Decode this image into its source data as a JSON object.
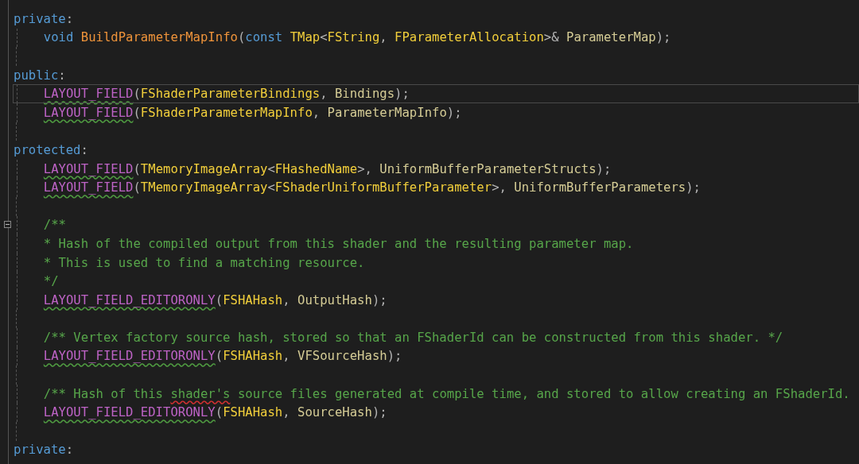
{
  "editor": {
    "lines": [
      {
        "kind": "code",
        "indented": false,
        "current": false,
        "fold": false,
        "tokens": [
          {
            "kind": "keyword",
            "text": "private"
          },
          {
            "kind": "punct",
            "text": ":"
          }
        ]
      },
      {
        "kind": "code",
        "indented": true,
        "current": false,
        "fold": false,
        "tokens": [
          {
            "kind": "keyword",
            "text": "void "
          },
          {
            "kind": "function",
            "text": "BuildParameterMapInfo"
          },
          {
            "kind": "punct",
            "text": "("
          },
          {
            "kind": "keyword",
            "text": "const "
          },
          {
            "kind": "type",
            "text": "TMap"
          },
          {
            "kind": "punct",
            "text": "<"
          },
          {
            "kind": "type",
            "text": "FString"
          },
          {
            "kind": "punct",
            "text": ", "
          },
          {
            "kind": "type",
            "text": "FParameterAllocation"
          },
          {
            "kind": "punct",
            "text": ">& "
          },
          {
            "kind": "param",
            "text": "ParameterMap"
          },
          {
            "kind": "punct",
            "text": ");"
          }
        ]
      },
      {
        "kind": "blank"
      },
      {
        "kind": "code",
        "indented": false,
        "current": false,
        "fold": false,
        "tokens": [
          {
            "kind": "keyword",
            "text": "public"
          },
          {
            "kind": "punct",
            "text": ":"
          }
        ]
      },
      {
        "kind": "code",
        "indented": true,
        "current": true,
        "fold": false,
        "tokens": [
          {
            "kind": "macro",
            "text": "LAYOUT_FIELD",
            "squiggly": true
          },
          {
            "kind": "punct",
            "text": "("
          },
          {
            "kind": "type",
            "text": "FShaderParameterBindings"
          },
          {
            "kind": "punct",
            "text": ", "
          },
          {
            "kind": "param",
            "text": "Bindings"
          },
          {
            "kind": "punct",
            "text": ");"
          }
        ]
      },
      {
        "kind": "code",
        "indented": true,
        "current": false,
        "fold": false,
        "tokens": [
          {
            "kind": "macro",
            "text": "LAYOUT_FIELD",
            "squiggly": true
          },
          {
            "kind": "punct",
            "text": "("
          },
          {
            "kind": "type",
            "text": "FShaderParameterMapInfo"
          },
          {
            "kind": "punct",
            "text": ", "
          },
          {
            "kind": "param",
            "text": "ParameterMapInfo"
          },
          {
            "kind": "punct",
            "text": ");"
          }
        ]
      },
      {
        "kind": "blank"
      },
      {
        "kind": "code",
        "indented": false,
        "current": false,
        "fold": false,
        "tokens": [
          {
            "kind": "keyword",
            "text": "protected"
          },
          {
            "kind": "punct",
            "text": ":"
          }
        ]
      },
      {
        "kind": "code",
        "indented": true,
        "current": false,
        "fold": false,
        "tokens": [
          {
            "kind": "macro",
            "text": "LAYOUT_FIELD",
            "squiggly": true
          },
          {
            "kind": "punct",
            "text": "("
          },
          {
            "kind": "type",
            "text": "TMemoryImageArray"
          },
          {
            "kind": "punct",
            "text": "<"
          },
          {
            "kind": "type",
            "text": "FHashedName"
          },
          {
            "kind": "punct",
            "text": ">, "
          },
          {
            "kind": "param",
            "text": "UniformBufferParameterStructs"
          },
          {
            "kind": "punct",
            "text": ");"
          }
        ]
      },
      {
        "kind": "code",
        "indented": true,
        "current": false,
        "fold": false,
        "tokens": [
          {
            "kind": "macro",
            "text": "LAYOUT_FIELD",
            "squiggly": true
          },
          {
            "kind": "punct",
            "text": "("
          },
          {
            "kind": "type",
            "text": "TMemoryImageArray"
          },
          {
            "kind": "punct",
            "text": "<"
          },
          {
            "kind": "type",
            "text": "FShaderUniformBufferParameter"
          },
          {
            "kind": "punct",
            "text": ">, "
          },
          {
            "kind": "param",
            "text": "UniformBufferParameters"
          },
          {
            "kind": "punct",
            "text": ");"
          }
        ]
      },
      {
        "kind": "blank"
      },
      {
        "kind": "code",
        "indented": true,
        "current": false,
        "fold": true,
        "tokens": [
          {
            "kind": "comment",
            "text": "/**"
          }
        ]
      },
      {
        "kind": "code",
        "indented": true,
        "current": false,
        "fold": false,
        "tokens": [
          {
            "kind": "comment",
            "text": "* Hash of the compiled output from this shader and the resulting parameter map."
          }
        ]
      },
      {
        "kind": "code",
        "indented": true,
        "current": false,
        "fold": false,
        "tokens": [
          {
            "kind": "comment",
            "text": "* This is used to find a matching resource."
          }
        ]
      },
      {
        "kind": "code",
        "indented": true,
        "current": false,
        "fold": false,
        "tokens": [
          {
            "kind": "comment",
            "text": "*/"
          }
        ]
      },
      {
        "kind": "code",
        "indented": true,
        "current": false,
        "fold": false,
        "tokens": [
          {
            "kind": "macro",
            "text": "LAYOUT_FIELD_EDITORONLY",
            "squiggly": true
          },
          {
            "kind": "punct",
            "text": "("
          },
          {
            "kind": "type",
            "text": "FSHAHash"
          },
          {
            "kind": "punct",
            "text": ", "
          },
          {
            "kind": "param",
            "text": "OutputHash"
          },
          {
            "kind": "punct",
            "text": ");"
          }
        ]
      },
      {
        "kind": "blank"
      },
      {
        "kind": "code",
        "indented": true,
        "current": false,
        "fold": false,
        "tokens": [
          {
            "kind": "comment",
            "text": "/** Vertex factory source hash, stored so that an FShaderId can be constructed from this shader. */"
          }
        ]
      },
      {
        "kind": "code",
        "indented": true,
        "current": false,
        "fold": false,
        "tokens": [
          {
            "kind": "macro",
            "text": "LAYOUT_FIELD_EDITORONLY",
            "squiggly": true
          },
          {
            "kind": "punct",
            "text": "("
          },
          {
            "kind": "type",
            "text": "FSHAHash"
          },
          {
            "kind": "punct",
            "text": ", "
          },
          {
            "kind": "param",
            "text": "VFSourceHash"
          },
          {
            "kind": "punct",
            "text": ");"
          }
        ]
      },
      {
        "kind": "blank"
      },
      {
        "kind": "code",
        "indented": true,
        "current": false,
        "fold": false,
        "tokens": [
          {
            "kind": "comment",
            "text": "/** Hash of this "
          },
          {
            "kind": "comment",
            "text": "shader's",
            "squiggly": true
          },
          {
            "kind": "comment",
            "text": " source files generated at compile time, and stored to allow creating an FShaderId."
          }
        ]
      },
      {
        "kind": "code",
        "indented": true,
        "current": false,
        "fold": false,
        "tokens": [
          {
            "kind": "macro",
            "text": "LAYOUT_FIELD_EDITORONLY",
            "squiggly": true
          },
          {
            "kind": "punct",
            "text": "("
          },
          {
            "kind": "type",
            "text": "FSHAHash"
          },
          {
            "kind": "punct",
            "text": ", "
          },
          {
            "kind": "param",
            "text": "SourceHash"
          },
          {
            "kind": "punct",
            "text": ");"
          }
        ]
      },
      {
        "kind": "blank"
      },
      {
        "kind": "code",
        "indented": false,
        "current": false,
        "fold": false,
        "tokens": [
          {
            "kind": "keyword",
            "text": "private"
          },
          {
            "kind": "punct",
            "text": ":"
          }
        ]
      }
    ]
  }
}
